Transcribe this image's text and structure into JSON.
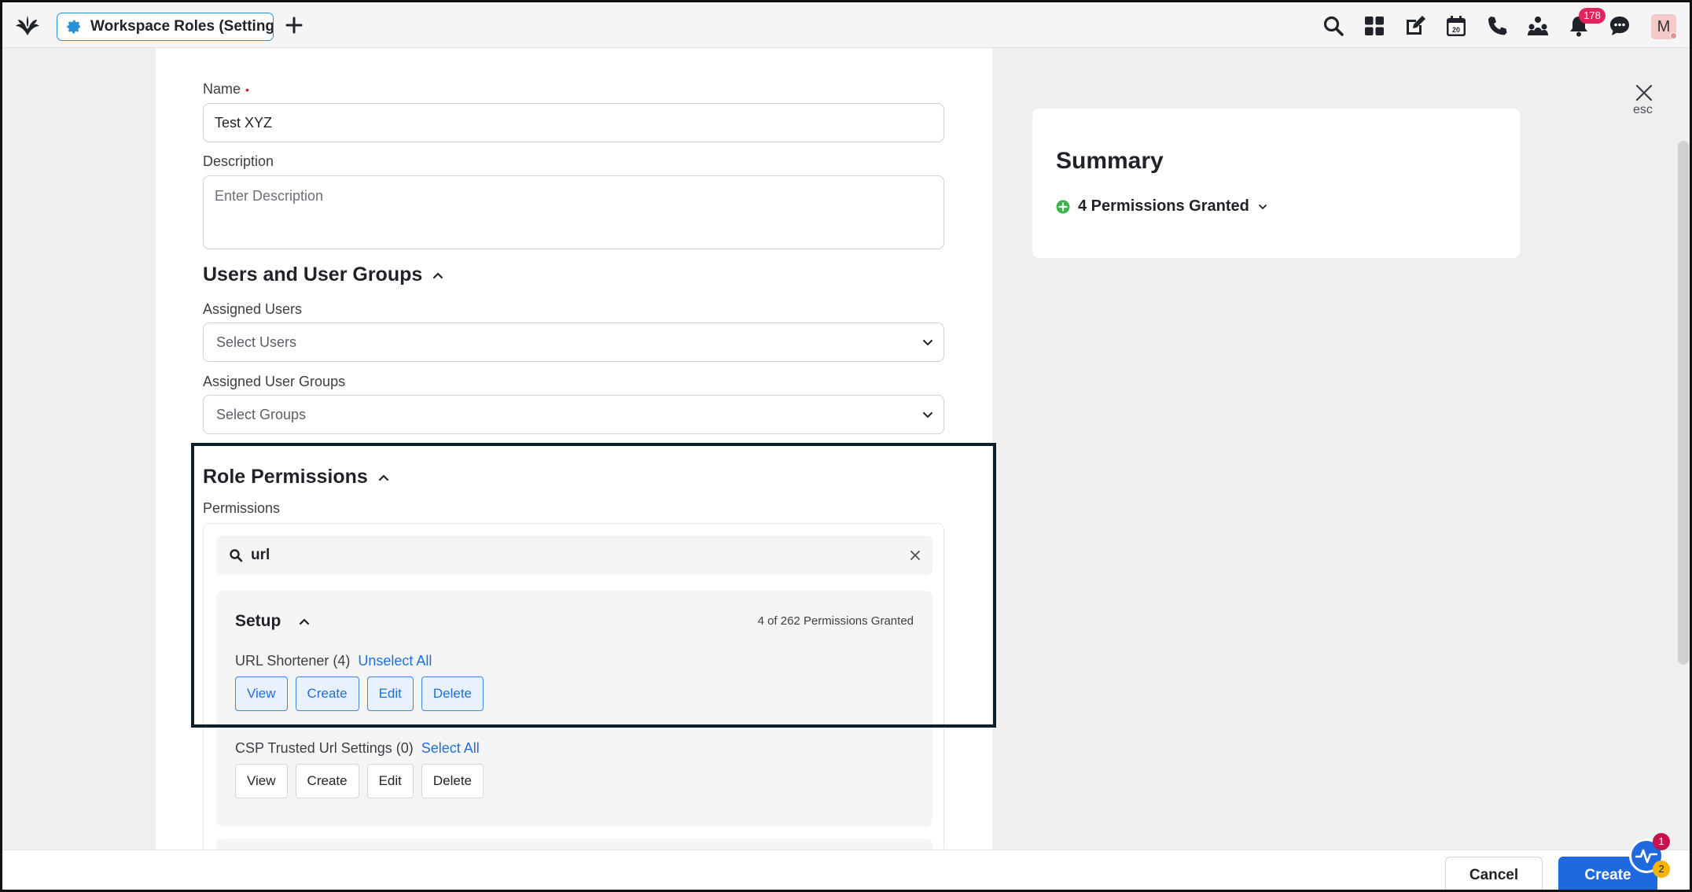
{
  "topbar": {
    "tab_title": "Workspace Roles (Settings",
    "notification_count": "178",
    "avatar_letter": "M",
    "icons": [
      "logo-icon",
      "gear-icon",
      "plus-icon",
      "search-icon",
      "apps-grid-icon",
      "compose-icon",
      "calendar-icon",
      "phone-icon",
      "community-icon",
      "bell-icon",
      "chat-icon"
    ],
    "calendar_day": "20"
  },
  "form": {
    "name_label": "Name",
    "name_required_mark": "•",
    "name_value": "Test XYZ",
    "description_label": "Description",
    "description_placeholder": "Enter Description",
    "users_section_title": "Users and User Groups",
    "assigned_users_label": "Assigned Users",
    "assigned_users_placeholder": "Select Users",
    "assigned_groups_label": "Assigned User Groups",
    "assigned_groups_placeholder": "Select Groups",
    "role_permissions_title": "Role Permissions",
    "permissions_label": "Permissions",
    "permission_search_value": "url"
  },
  "permission_groups": [
    {
      "title": "Setup",
      "granted_text": "4 of 262 Permissions Granted",
      "items": [
        {
          "name": "URL Shortener (4)",
          "action_link": "Unselect All",
          "buttons": [
            {
              "label": "View",
              "selected": true
            },
            {
              "label": "Create",
              "selected": true
            },
            {
              "label": "Edit",
              "selected": true
            },
            {
              "label": "Delete",
              "selected": true
            }
          ]
        },
        {
          "name": "CSP Trusted Url Settings (0)",
          "action_link": "Select All",
          "buttons": [
            {
              "label": "View",
              "selected": false
            },
            {
              "label": "Create",
              "selected": false
            },
            {
              "label": "Edit",
              "selected": false
            },
            {
              "label": "Delete",
              "selected": false
            }
          ]
        }
      ]
    }
  ],
  "summary": {
    "title": "Summary",
    "permissions_granted": "4 Permissions Granted",
    "close_hint": "esc"
  },
  "footer": {
    "cancel_label": "Cancel",
    "create_label": "Create",
    "pulse_badge_1": "1",
    "pulse_badge_2": "2"
  },
  "colors": {
    "accent": "#1f69e0",
    "link": "#1e6fd9",
    "selected_bg": "#e8f1fd",
    "badge": "#e0245e",
    "success": "#3cb44b"
  }
}
